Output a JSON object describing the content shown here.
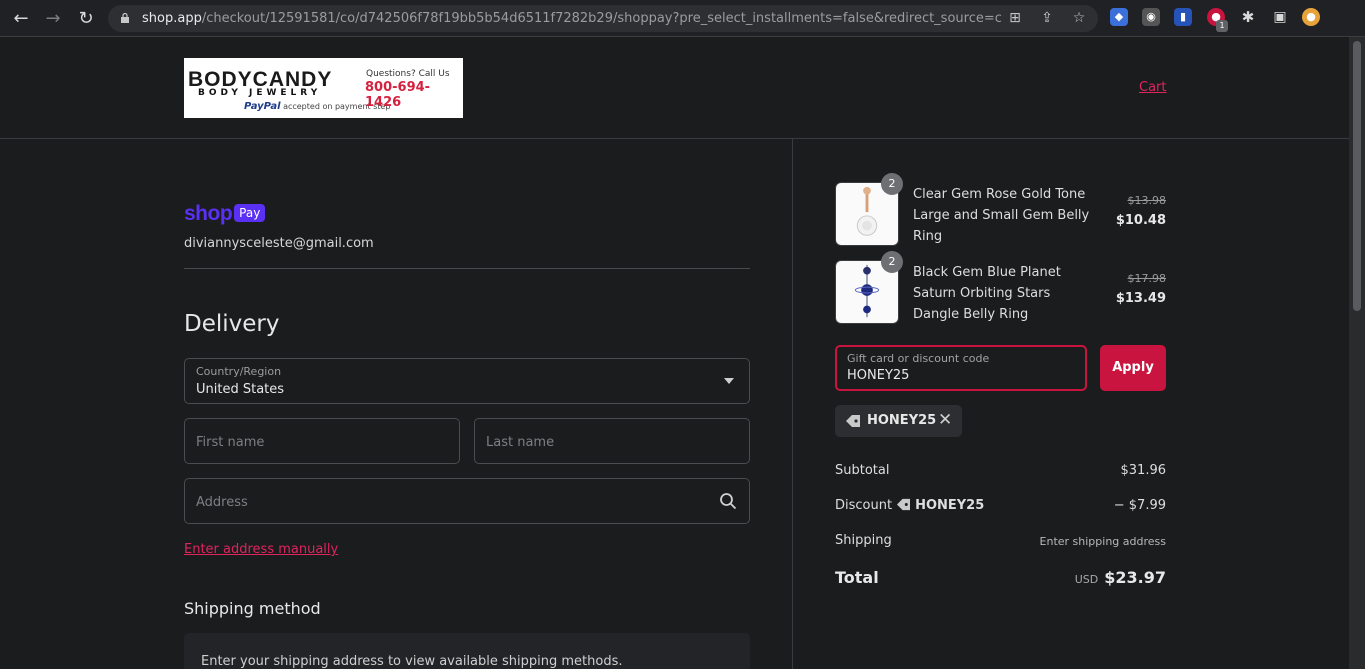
{
  "browser": {
    "url_host": "shop.app",
    "url_rest": "/checkout/12591581/co/d742506f78f19bb5b54d6511f7282b29/shoppay?pre_select_installments=false&redirect_source=check...",
    "extension_badge": "1"
  },
  "header": {
    "logo_brand": "BODYCANDY",
    "logo_sub": "BODY JEWELRY",
    "logo_question": "Questions? Call Us",
    "logo_phone": "800-694-1426",
    "logo_paypal": "PayPal",
    "logo_paypal_note": "accepted on payment step",
    "cart_label": "Cart"
  },
  "account": {
    "shop_word": "shop",
    "pay_word": "Pay",
    "email": "diviannysceleste@gmail.com"
  },
  "delivery": {
    "title": "Delivery",
    "country_label": "Country/Region",
    "country_value": "United States",
    "first_name_placeholder": "First name",
    "last_name_placeholder": "Last name",
    "address_placeholder": "Address",
    "manual_link": "Enter address manually"
  },
  "shipping": {
    "title": "Shipping method",
    "note": "Enter your shipping address to view available shipping methods."
  },
  "summary": {
    "items": [
      {
        "qty": "2",
        "name": "Clear Gem Rose Gold Tone Large and Small Gem Belly Ring",
        "original": "$13.98",
        "price": "$10.48"
      },
      {
        "qty": "2",
        "name": "Black Gem Blue Planet Saturn Orbiting Stars Dangle Belly Ring",
        "original": "$17.98",
        "price": "$13.49"
      }
    ],
    "code_label": "Gift card or discount code",
    "code_value": "HONEY25",
    "apply_label": "Apply",
    "chip_code": "HONEY25",
    "subtotal_label": "Subtotal",
    "subtotal_value": "$31.96",
    "discount_label": "Discount",
    "discount_code": "HONEY25",
    "discount_value": "− $7.99",
    "shipping_label": "Shipping",
    "shipping_value": "Enter shipping address",
    "total_label": "Total",
    "currency": "USD",
    "total_value": "$23.97"
  },
  "colors": {
    "accent": "#c8143f",
    "link": "#e0245e",
    "shop_pay": "#5a31f4",
    "background": "#1b1c1e"
  },
  "icons": [
    "back-icon",
    "forward-icon",
    "reload-icon",
    "lock-icon",
    "translate-icon",
    "share-icon",
    "star-icon",
    "extensions-icon",
    "sidepanel-icon",
    "search-icon",
    "chevron-down-icon",
    "tag-icon",
    "close-icon"
  ]
}
